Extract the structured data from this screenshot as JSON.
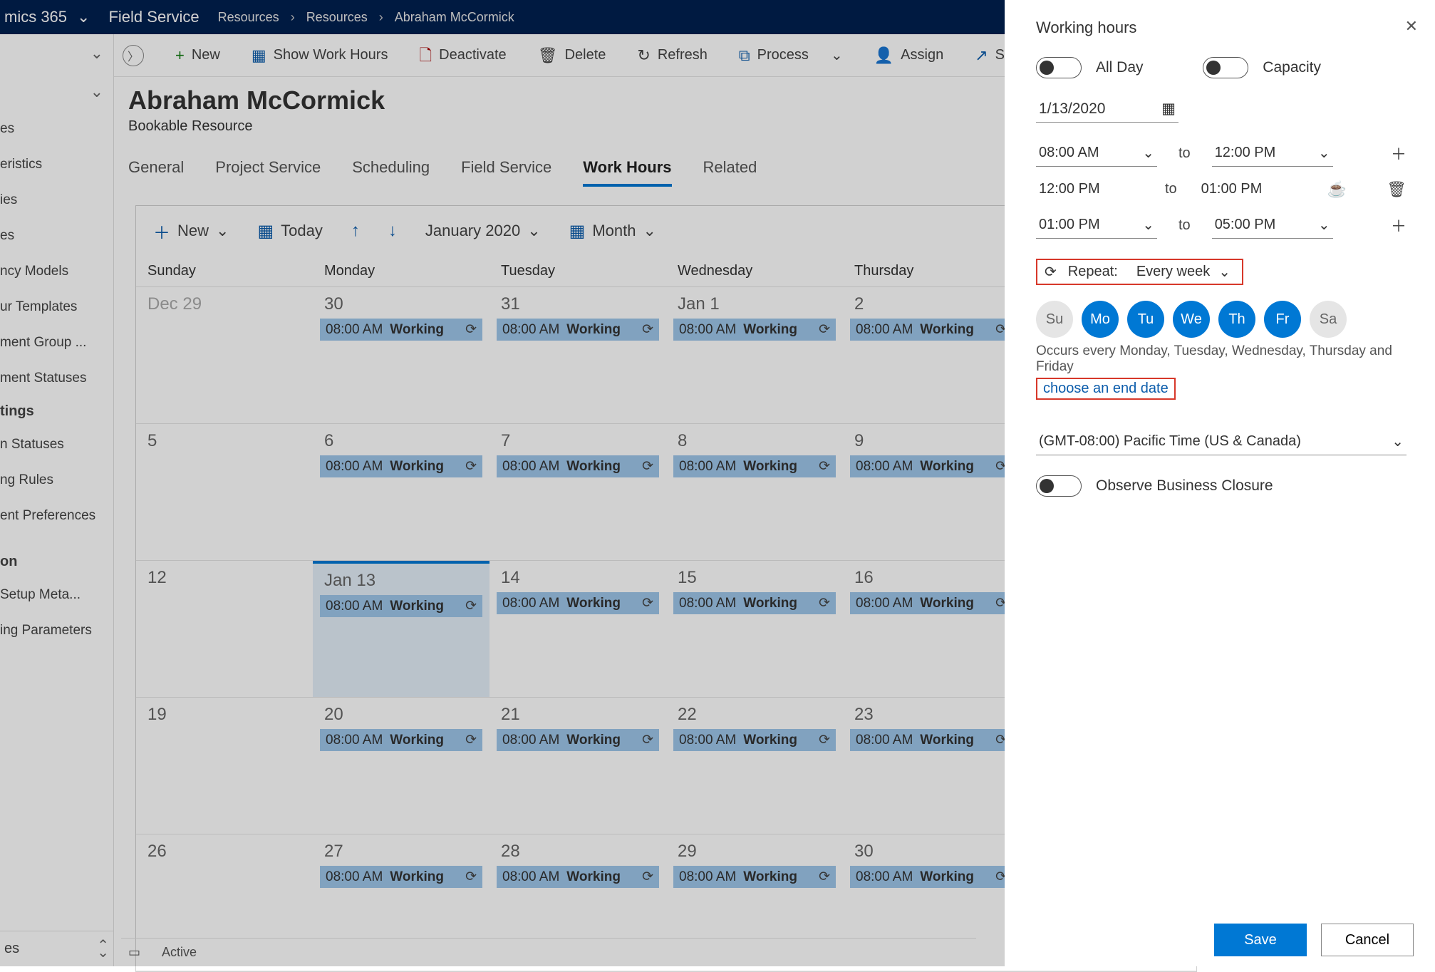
{
  "topnav": {
    "brand": "mics 365",
    "area": "Field Service",
    "crumbs": [
      "Resources",
      "Resources",
      "Abraham McCormick"
    ]
  },
  "sidebar": {
    "items_top": [
      "es",
      "eristics",
      "ies",
      "es",
      "ncy Models",
      "ur Templates",
      "ment Group ...",
      "ment Statuses"
    ],
    "section": "tings",
    "items_bottom": [
      "n Statuses",
      "ng Rules",
      "ent Preferences"
    ],
    "section2": "on",
    "items_bottom2": [
      "Setup Meta...",
      "ing Parameters"
    ],
    "footer": "es"
  },
  "cmdbar": {
    "new": "New",
    "show_wh": "Show Work Hours",
    "deactivate": "Deactivate",
    "delete": "Delete",
    "refresh": "Refresh",
    "process": "Process",
    "assign": "Assign",
    "share": "Sh"
  },
  "record": {
    "title": "Abraham McCormick",
    "subtitle": "Bookable Resource"
  },
  "tabs": [
    "General",
    "Project Service",
    "Scheduling",
    "Field Service",
    "Work Hours",
    "Related"
  ],
  "active_tab": "Work Hours",
  "cal_toolbar": {
    "new": "New",
    "today": "Today",
    "label": "January 2020",
    "view": "Month"
  },
  "cal_headers": [
    "Sunday",
    "Monday",
    "Tuesday",
    "Wednesday",
    "Thursday",
    ""
  ],
  "event_time": "08:00 AM",
  "event_text": "Working",
  "weeks": [
    {
      "days": [
        {
          "label": "Dec 29",
          "muted": true,
          "event": false
        },
        {
          "label": "30",
          "event": true
        },
        {
          "label": "31",
          "event": true
        },
        {
          "label": "Jan 1",
          "event": true
        },
        {
          "label": "2",
          "event": true
        },
        {
          "label": "",
          "event": false
        }
      ]
    },
    {
      "days": [
        {
          "label": "5",
          "event": false
        },
        {
          "label": "6",
          "event": true
        },
        {
          "label": "7",
          "event": true
        },
        {
          "label": "8",
          "event": true
        },
        {
          "label": "9",
          "event": true
        },
        {
          "label": "",
          "event": false
        }
      ]
    },
    {
      "days": [
        {
          "label": "12",
          "event": false
        },
        {
          "label": "Jan 13",
          "event": true,
          "selected": true
        },
        {
          "label": "14",
          "event": true
        },
        {
          "label": "15",
          "event": true
        },
        {
          "label": "16",
          "event": true
        },
        {
          "label": "",
          "event": false
        }
      ]
    },
    {
      "days": [
        {
          "label": "19",
          "event": false
        },
        {
          "label": "20",
          "event": true
        },
        {
          "label": "21",
          "event": true
        },
        {
          "label": "22",
          "event": true
        },
        {
          "label": "23",
          "event": true
        },
        {
          "label": "",
          "event": false
        }
      ]
    },
    {
      "days": [
        {
          "label": "26",
          "event": false
        },
        {
          "label": "27",
          "event": true
        },
        {
          "label": "28",
          "event": true
        },
        {
          "label": "29",
          "event": true
        },
        {
          "label": "30",
          "event": true
        },
        {
          "label": "",
          "event": false
        }
      ]
    }
  ],
  "panel": {
    "title": "Working hours",
    "all_day": "All Day",
    "capacity": "Capacity",
    "date": "1/13/2020",
    "slots": [
      {
        "from": "08:00 AM",
        "to_label": "to",
        "to": "12:00 PM",
        "dropdown": true,
        "action": "plus"
      },
      {
        "from": "12:00 PM",
        "to_label": "to",
        "to": "01:00 PM",
        "dropdown": false,
        "action": "coffee-trash"
      },
      {
        "from": "01:00 PM",
        "to_label": "to",
        "to": "05:00 PM",
        "dropdown": true,
        "action": "plus"
      }
    ],
    "repeat_label": "Repeat:",
    "repeat_value": "Every week",
    "days": [
      {
        "abbr": "Su",
        "on": false
      },
      {
        "abbr": "Mo",
        "on": true
      },
      {
        "abbr": "Tu",
        "on": true
      },
      {
        "abbr": "We",
        "on": true
      },
      {
        "abbr": "Th",
        "on": true
      },
      {
        "abbr": "Fr",
        "on": true
      },
      {
        "abbr": "Sa",
        "on": false
      }
    ],
    "occurs": "Occurs every Monday, Tuesday, Wednesday, Thursday and Friday",
    "choose_end": "choose an end date",
    "timezone": "(GMT-08:00) Pacific Time (US & Canada)",
    "observe": "Observe Business Closure",
    "save": "Save",
    "cancel": "Cancel"
  },
  "status": {
    "field": "",
    "value": "Active"
  }
}
